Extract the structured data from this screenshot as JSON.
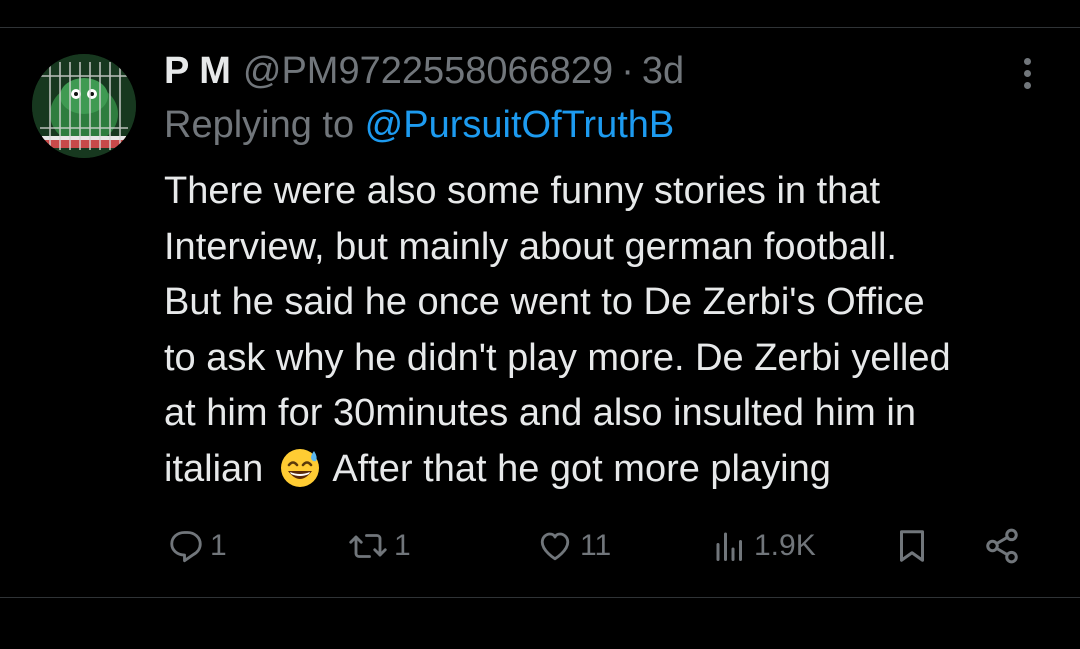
{
  "tweet": {
    "display_name": "P M",
    "handle": "@PM9722558066829",
    "separator": "·",
    "time": "3d",
    "replying_prefix": "Replying to ",
    "replying_to": "@PursuitOfTruthB",
    "body_lines": [
      "There were also some funny stories in that",
      "Interview, but mainly about german football.",
      "But he said he once went to De Zerbi's Office",
      "to ask why he didn't play more. De Zerbi yelled",
      "at him for 30minutes and also insulted him in"
    ],
    "last_line_before_emoji": "italian",
    "last_line_after_emoji": "After that he got more playing",
    "emoji_icon": "grinning-face-with-sweat-emoji"
  },
  "actions": {
    "replies": "1",
    "reposts": "1",
    "likes": "11",
    "views": "1.9K"
  },
  "colors": {
    "background": "#000000",
    "text_primary": "#e7e9ea",
    "text_secondary": "#71767b",
    "accent_blue": "#1d9bf0",
    "divider": "#2f3336"
  }
}
